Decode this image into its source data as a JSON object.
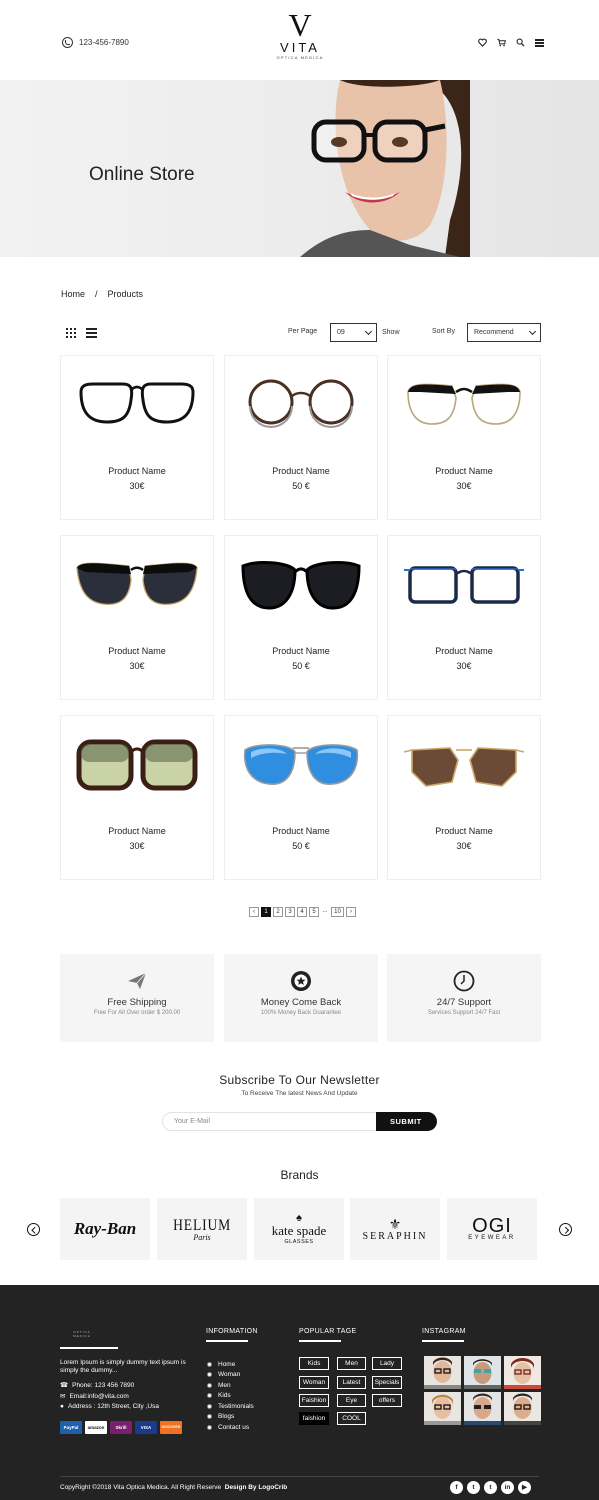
{
  "header": {
    "phone": "123-456-7890",
    "logo_mark": "V",
    "logo_name": "VITA",
    "logo_sub": "OPTICA MEDICA",
    "icons": [
      "heart-icon",
      "cart-icon",
      "search-icon",
      "menu-icon"
    ]
  },
  "hero": {
    "title": "Online Store"
  },
  "breadcrumb": {
    "home": "Home",
    "separator": "/",
    "current": "Products"
  },
  "toolbar": {
    "per_page_label": "Per Page",
    "per_page_value": "09",
    "show_label": "Show",
    "sort_label": "Sort By",
    "sort_value": "Recommend"
  },
  "products": [
    {
      "name": "Product Name",
      "price": "30€"
    },
    {
      "name": "Product Name",
      "price": "50 €"
    },
    {
      "name": "Product Name",
      "price": "30€"
    },
    {
      "name": "Product Name",
      "price": "30€"
    },
    {
      "name": "Product Name",
      "price": "50 €"
    },
    {
      "name": "Product Name",
      "price": "30€"
    },
    {
      "name": "Product Name",
      "price": "30€"
    },
    {
      "name": "Product Name",
      "price": "50 €"
    },
    {
      "name": "Product Name",
      "price": "30€"
    }
  ],
  "pagination": {
    "prev": "‹",
    "pages": [
      "1",
      "2",
      "3",
      "4",
      "5"
    ],
    "dots": "...",
    "last": "10",
    "next": "›",
    "current": "1"
  },
  "features": [
    {
      "title": "Free Shipping",
      "subtitle": "Free For All Over order $ 200.00",
      "icon": "paper-plane-icon"
    },
    {
      "title": "Money Come Back",
      "subtitle": "100% Money Back Guarantee",
      "icon": "badge-icon"
    },
    {
      "title": "24/7 Support",
      "subtitle": "Services Support 24/7 Fast",
      "icon": "clock-icon"
    }
  ],
  "newsletter": {
    "title": "Subscribe To Our Newsletter",
    "subtitle": "To Receive The latest News And Update",
    "placeholder": "Your E-Mail",
    "button": "SUBMIT"
  },
  "brands": {
    "title": "Brands",
    "items": [
      {
        "name": "Ray-Ban",
        "sub": ""
      },
      {
        "name": "HELIUM",
        "sub": "Paris"
      },
      {
        "name": "kate spade",
        "sub": "GLASSES"
      },
      {
        "name": "SERAPHIN",
        "sub": ""
      },
      {
        "name": "OGI",
        "sub": "EYEWEAR"
      }
    ]
  },
  "footer": {
    "logo_mark": "V",
    "logo_name": "VITA",
    "logo_sub": "OPTICA MEDICA",
    "about": "Lorem Ipsum is simply dummy text ipsum is simply the  dummy...",
    "phone": "Phone: 123 456 7890",
    "email": "Email:info@vita.com",
    "address": "Address : 12th Street, City ,Usa",
    "payments": [
      "PayPal",
      "amazon",
      "Skrill",
      "VISA",
      "DISCOVER"
    ],
    "information_title": "INFORMATION",
    "information_links": [
      "Home",
      "Woman",
      "Men",
      "Kids",
      "Testimonials",
      "Blogs",
      "Contact us"
    ],
    "tags_title": "POPULAR TAGE",
    "tags": [
      "Kids",
      "Men",
      "Lady",
      "Woman",
      "Latest",
      "Specials",
      "Faishion",
      "Eye",
      "offers",
      "faishion",
      "COOL"
    ],
    "instagram_title": "INSTAGRAM",
    "copyright": "CopyRight ©2018 Vita Optica Medica. All Right Reserve",
    "design_by": "Design By LogoCrib",
    "socials": [
      "f",
      "t",
      "t",
      "in",
      "▶"
    ]
  },
  "colors": {
    "dark": "#232323",
    "accent": "#111111",
    "panel": "#f5f5f5"
  }
}
